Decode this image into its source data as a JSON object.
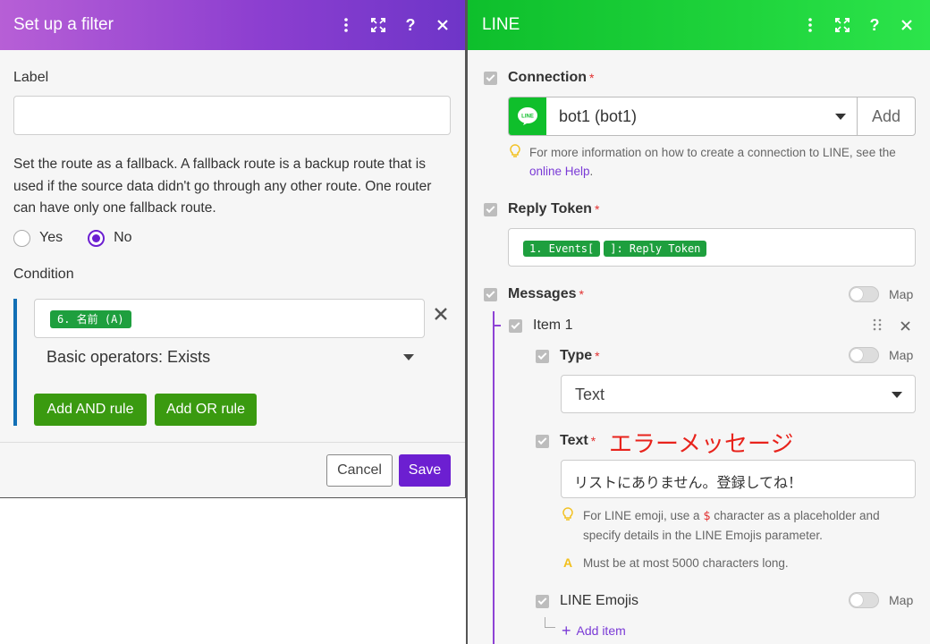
{
  "filter_panel": {
    "title": "Set up a filter",
    "label_field": {
      "label": "Label",
      "value": ""
    },
    "fallback_description": "Set the route as a fallback. A fallback route is a backup route that is used if the source data didn't go through any other route. One router can have only one fallback route.",
    "fallback_options": {
      "yes_label": "Yes",
      "no_label": "No",
      "selected": "No"
    },
    "condition": {
      "label": "Condition",
      "operand_pill": "6. 名前 (A)",
      "operator": "Basic operators: Exists",
      "add_and_rule": "Add AND rule",
      "add_or_rule": "Add OR rule"
    },
    "cancel_label": "Cancel",
    "save_label": "Save"
  },
  "line_panel": {
    "title": "LINE",
    "connection": {
      "label": "Connection",
      "required": "*",
      "selected": "bot1 (bot1)",
      "add_label": "Add",
      "logo_text": "LINE",
      "hint_prefix": "For more information on how to create a connection to LINE, see the ",
      "hint_link": "online Help",
      "hint_suffix": "."
    },
    "reply_token": {
      "label": "Reply Token",
      "required": "*",
      "pill_1": "1. Events[",
      "pill_2": "]: Reply Token"
    },
    "messages": {
      "label": "Messages",
      "required": "*",
      "map_label": "Map",
      "item_label": "Item 1",
      "type": {
        "label": "Type",
        "required": "*",
        "map_label": "Map",
        "value": "Text"
      },
      "text": {
        "label": "Text",
        "required": "*",
        "annotation": "エラーメッセージ",
        "value": "リストにありません。登録してね！",
        "hint_before": "For LINE emoji, use a ",
        "hint_dollar": "$",
        "hint_after": " character as a placeholder and specify details in the LINE Emojis parameter.",
        "limit_hint": "Must be at most 5000 characters long."
      },
      "line_emojis": {
        "label": "LINE Emojis",
        "map_label": "Map",
        "add_item": "Add item"
      }
    }
  },
  "colors": {
    "filter_header": "#8d3fd0",
    "line_header": "#1fd43c",
    "save_button": "#6c1fd1",
    "rule_button": "#3a9a10",
    "pill": "#1e9f3e",
    "annotation": "#e8231c"
  }
}
